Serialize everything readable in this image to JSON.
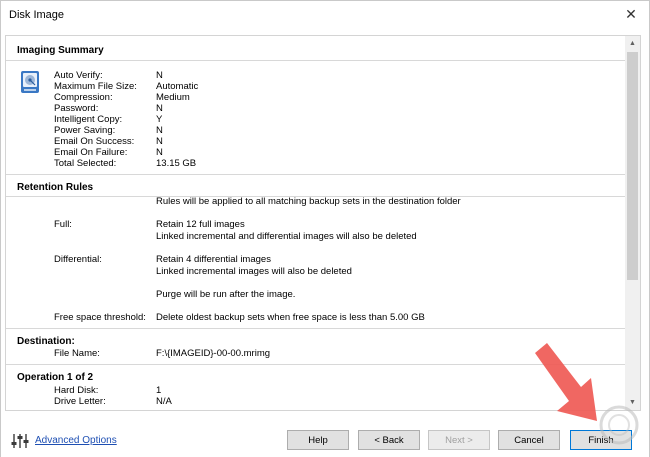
{
  "window": {
    "title": "Disk Image",
    "close_glyph": "✕"
  },
  "imaging_summary": {
    "title": "Imaging Summary",
    "rows": [
      {
        "label": "Auto Verify:",
        "value": "N"
      },
      {
        "label": "Maximum File Size:",
        "value": "Automatic"
      },
      {
        "label": "Compression:",
        "value": "Medium"
      },
      {
        "label": "Password:",
        "value": "N"
      },
      {
        "label": "Intelligent Copy:",
        "value": "Y"
      },
      {
        "label": "Power Saving:",
        "value": "N"
      },
      {
        "label": "Email On Success:",
        "value": "N"
      },
      {
        "label": "Email On Failure:",
        "value": "N"
      },
      {
        "label": "Total Selected:",
        "value": "13.15 GB"
      }
    ]
  },
  "retention_rules": {
    "title": "Retention Rules",
    "intro": "Rules will be applied to all matching backup sets in the destination folder",
    "full_label": "Full:",
    "full_line1": "Retain 12 full images",
    "full_line2": "Linked incremental and differential images will also be deleted",
    "diff_label": "Differential:",
    "diff_line1": "Retain 4 differential images",
    "diff_line2": "Linked incremental images will also be deleted",
    "purge": "Purge will be run after the image.",
    "threshold_label": "Free space threshold:",
    "threshold_value": "Delete oldest backup sets when free space is less than 5.00 GB"
  },
  "destination": {
    "title": "Destination:",
    "file_label": "File Name:",
    "file_value": "F:\\{IMAGEID}-00-00.mrimg"
  },
  "operation": {
    "title": "Operation 1 of 2",
    "rows": [
      {
        "label": "Hard Disk:",
        "value": "1"
      },
      {
        "label": "Drive Letter:",
        "value": "N/A"
      }
    ]
  },
  "footer": {
    "advanced_options": "Advanced Options",
    "help": "Help",
    "back": "< Back",
    "next": "Next >",
    "cancel": "Cancel",
    "finish": "Finish"
  },
  "icons": {
    "disk": "disk-icon",
    "advanced": "sliders-icon",
    "scroll_up": "chevron-up-icon",
    "scroll_down": "chevron-down-icon",
    "callout_arrow": "arrow-down-right-icon"
  },
  "colors": {
    "link": "#1e4fb3",
    "arrow": "#ef5a55",
    "focus": "#0078d7"
  }
}
